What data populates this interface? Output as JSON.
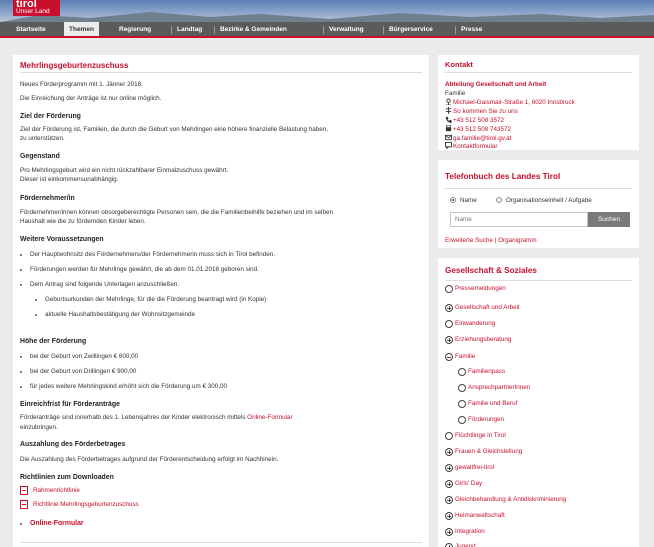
{
  "logo": {
    "line1": "tirol",
    "line2": "Unser Land"
  },
  "nav": {
    "items": [
      "Startseite",
      "Themen",
      "Regierung",
      "Landtag",
      "Bezirke & Gemeinden",
      "Verwaltung",
      "Bürgerservice",
      "Presse"
    ],
    "active": "Themen"
  },
  "main": {
    "title": "Mehrlingsgeburtenzuschuss",
    "intro1": "Neues Förderprogramm mit 1. Jänner 2018.",
    "intro2": "Die Einreichung der Anträge ist nur online möglich.",
    "ziel_h": "Ziel der Förderung",
    "ziel_1": "Ziel der Förderung ist, Familien, die durch die Geburt von Mehrlingen eine höhere finanzielle Belastung haben,",
    "ziel_2": "zu unterstützen.",
    "geg_h": "Gegenstand",
    "geg_1": "Pro Mehrlingsgeburt wird ein nicht rückzahlbarer Einmalzuschuss gewährt.",
    "geg_2": "Dieser ist einkommensunabhängig.",
    "fn_h": "Fördernehmer/in",
    "fn_1": "Fördernehmer/innen können obsorgeberechtigte Personen sein, die die Familienbeihilfe beziehen und im selben",
    "fn_2": "Haushalt wie die zu fördernden Kinder leben.",
    "wv_h": "Weitere Voraussetzungen",
    "wv_1": "Der Hauptwohnsitz des Fördernehmers/der Förderneh­merin muss sich in Tirol befinden.",
    "wv_2": "Förderungen werden für Mehrlinge gewährt, die ab dem 01.01.2018 geboren sind.",
    "wv_3": "Dem Antrag sind folgende Unterlagen anzuschließen:",
    "wv_3a": "Geburtsurkunden der Mehrlinge, für die die Förderung beantragt wird (in Kopie)",
    "wv_3b": "aktuelle Haushaltsbestätigung der Wohnsitzgemeinde",
    "hoehe_h": "Höhe der Förderung",
    "hoehe_1": "bei der Geburt von Zwillingen € 600,00",
    "hoehe_2": "bei der Geburt von Drillingen € 900,00",
    "hoehe_3": "für jedes weitere Mehrlingskind erhöht sich die Förderung um € 300,00",
    "frist_h": "Einreichfrist für Förderanträge",
    "frist_1": "Förderanträge sind innerhalb des 1. Lebensjahres der Kinder elektronisch mittels",
    "frist_link": "Online-Formular",
    "frist_2": "einzubringen.",
    "ausz_h": "Auszahlung des Förderbetrages",
    "ausz_1": "Die Auszahlung des Förderbetrages aufgrund der Förderentscheidung erfolgt im Nachhinein.",
    "dl_h": "Richtlinien zum Downloaden",
    "dl_1": "Rahmenrichtlinie",
    "dl_2": "Richtlinie Mehrlingsgeburtenzuschuss",
    "online": "Online-Formular"
  },
  "kontakt": {
    "title": "Kontakt",
    "org": "Abteilung Gesellschaft und Arbeit",
    "sub": "Familie",
    "address": "Michael-Gaismair-Straße 1, 6020 Innsbruck",
    "directions": "So kommen Sie zu uns",
    "phone": "+43 512 508 3572",
    "fax": "+43 512 508 743572",
    "email": "ga.familie@tirol.gv.at",
    "form": "Kontaktformular"
  },
  "telefon": {
    "title": "Telefonbuch des Landes Tirol",
    "radio1": "Name",
    "radio2": "Organisationseinheit / Aufgabe",
    "placeholder": "Name",
    "button": "Suchen",
    "link": "Erweiterte Suche | Organigramm"
  },
  "gesellschaft": {
    "title": "Gesellschaft & Soziales",
    "items": [
      {
        "label": "Pressemeldungen",
        "icon": "circle"
      },
      {
        "label": "Gesellschaft und Arbeit",
        "icon": "plus"
      },
      {
        "label": "Einwanderung",
        "icon": "circle"
      },
      {
        "label": "Erziehungsberatung",
        "icon": "plus"
      },
      {
        "label": "Familie",
        "icon": "minus"
      },
      {
        "label": "Familienpass",
        "icon": "circle"
      },
      {
        "label": "AnsprechpartnerInnen",
        "icon": "circle"
      },
      {
        "label": "Familie und Beruf",
        "icon": "circle"
      },
      {
        "label": "Förderungen",
        "icon": "circle"
      },
      {
        "label": "Flüchtlinge in Tirol",
        "icon": "circle"
      },
      {
        "label": "Frauen & Gleichstellung",
        "icon": "plus"
      },
      {
        "label": "gewaltfrei-tirol",
        "icon": "plus"
      },
      {
        "label": "Girls' Day",
        "icon": "plus"
      },
      {
        "label": "Gleichbehandlung & Antidiskriminierung",
        "icon": "plus"
      },
      {
        "label": "Heimanwaltschaft",
        "icon": "plus"
      },
      {
        "label": "Integration",
        "icon": "plus"
      },
      {
        "label": "Jugend",
        "icon": "plus"
      }
    ]
  }
}
